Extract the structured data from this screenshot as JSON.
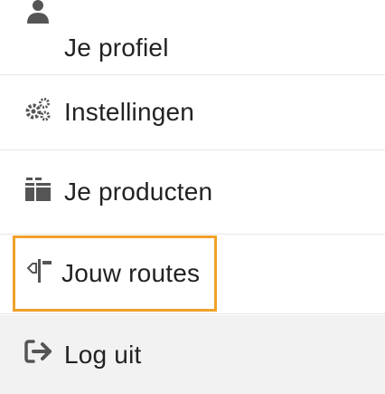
{
  "menu": {
    "items": [
      {
        "label": "Je profiel",
        "icon": "user-icon"
      },
      {
        "label": "Instellingen",
        "icon": "gears-icon"
      },
      {
        "label": "Je producten",
        "icon": "products-icon"
      },
      {
        "label": "Jouw routes",
        "icon": "routes-icon"
      },
      {
        "label": "Log uit",
        "icon": "logout-icon"
      }
    ]
  },
  "colors": {
    "highlight_border": "#f0a12a",
    "logout_background": "#f2f2f2",
    "text": "#222222",
    "icon": "#555555"
  }
}
